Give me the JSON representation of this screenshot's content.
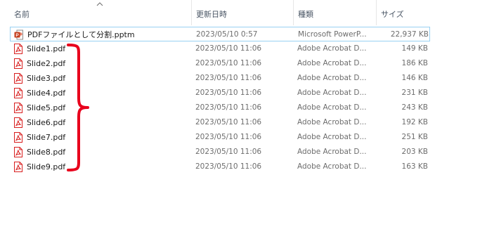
{
  "columns": {
    "name": "名前",
    "date": "更新日時",
    "type": "種類",
    "size": "サイズ"
  },
  "colors": {
    "selection_border": "#99d1f2",
    "pdf_red": "#d81e1e",
    "ppt_orange": "#c43e1c",
    "brace_red": "#e8001c"
  },
  "files": [
    {
      "name": "PDFファイルとして分割.pptm",
      "date": "2023/05/10 0:57",
      "type": "Microsoft PowerP...",
      "size": "22,937 KB",
      "icon": "powerpoint-file-icon"
    },
    {
      "name": "Slide1.pdf",
      "date": "2023/05/10 11:06",
      "type": "Adobe Acrobat D...",
      "size": "149 KB",
      "icon": "pdf-file-icon"
    },
    {
      "name": "Slide2.pdf",
      "date": "2023/05/10 11:06",
      "type": "Adobe Acrobat D...",
      "size": "186 KB",
      "icon": "pdf-file-icon"
    },
    {
      "name": "Slide3.pdf",
      "date": "2023/05/10 11:06",
      "type": "Adobe Acrobat D...",
      "size": "146 KB",
      "icon": "pdf-file-icon"
    },
    {
      "name": "Slide4.pdf",
      "date": "2023/05/10 11:06",
      "type": "Adobe Acrobat D...",
      "size": "231 KB",
      "icon": "pdf-file-icon"
    },
    {
      "name": "Slide5.pdf",
      "date": "2023/05/10 11:06",
      "type": "Adobe Acrobat D...",
      "size": "243 KB",
      "icon": "pdf-file-icon"
    },
    {
      "name": "Slide6.pdf",
      "date": "2023/05/10 11:06",
      "type": "Adobe Acrobat D...",
      "size": "192 KB",
      "icon": "pdf-file-icon"
    },
    {
      "name": "Slide7.pdf",
      "date": "2023/05/10 11:06",
      "type": "Adobe Acrobat D...",
      "size": "251 KB",
      "icon": "pdf-file-icon"
    },
    {
      "name": "Slide8.pdf",
      "date": "2023/05/10 11:06",
      "type": "Adobe Acrobat D...",
      "size": "203 KB",
      "icon": "pdf-file-icon"
    },
    {
      "name": "Slide9.pdf",
      "date": "2023/05/10 11:06",
      "type": "Adobe Acrobat D...",
      "size": "163 KB",
      "icon": "pdf-file-icon"
    }
  ]
}
